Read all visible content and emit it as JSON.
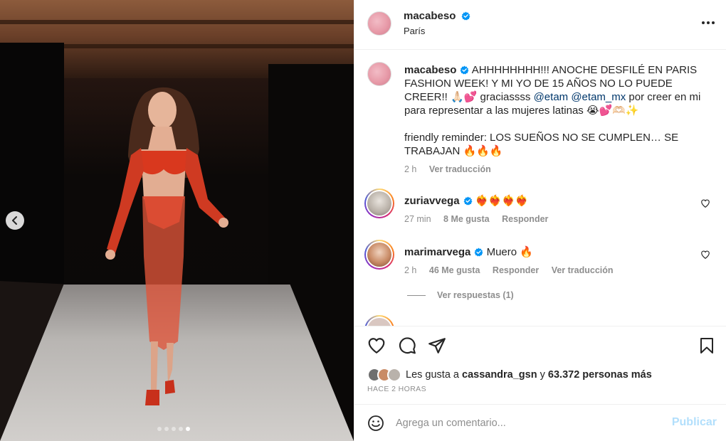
{
  "post": {
    "username": "macabeso",
    "location": "París"
  },
  "caption": {
    "username": "macabeso",
    "text_1": "AHHHHHHHH!!! ANOCHE DESFILÉ EN PARIS FASHION WEEK! Y MI YO DE 15 AÑOS NO LO PUEDE CREER!!",
    "emoji_1": "🙏🏻💕",
    "text_2": " graciassss ",
    "mention_1": "@etam",
    "mention_2": "@etam_mx",
    "text_3": " por creer en mi para representar a las mujeres latinas ",
    "emoji_2": "😭💕🫶🏻✨",
    "text_4": "friendly reminder: LOS SUEÑOS NO SE CUMPLEN… SE TRABAJAN ",
    "emoji_3": "🔥🔥🔥",
    "time": "2 h",
    "translate": "Ver traducción"
  },
  "comments": [
    {
      "username": "zuriavvega",
      "text": "❤️‍🔥❤️‍🔥❤️‍🔥❤️‍🔥",
      "time": "27 min",
      "likes": "8 Me gusta",
      "reply": "Responder"
    },
    {
      "username": "marimarvega",
      "text": "Muero 🔥",
      "time": "2 h",
      "likes": "46 Me gusta",
      "reply": "Responder",
      "translate": "Ver traducción",
      "view_replies": "Ver respuestas (1)"
    }
  ],
  "likes": {
    "prefix": "Les gusta a ",
    "user": "cassandra_gsn",
    "middle": " y ",
    "count": "63.372 personas más"
  },
  "time_ago": "HACE 2 HORAS",
  "composer": {
    "placeholder": "Agrega un comentario...",
    "post_label": "Publicar"
  },
  "carousel": {
    "slides": 5,
    "active_index": 4
  },
  "colors": {
    "verified": "#0095f6",
    "mention": "#00376b",
    "muted": "#8e8e8e",
    "post_disabled": "#b2dffc",
    "dress": "#d9381e"
  },
  "icons": [
    "chevron-left-icon",
    "more-icon",
    "verified-icon",
    "heart-icon",
    "comment-icon",
    "share-icon",
    "bookmark-icon",
    "emoji-icon"
  ]
}
